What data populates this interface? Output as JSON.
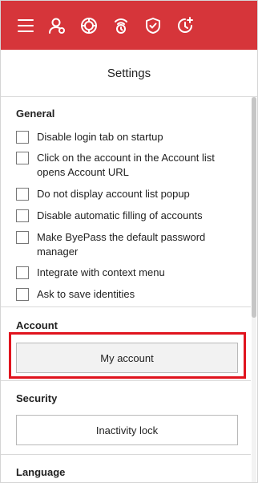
{
  "toolbar": {
    "accent": "#d6353a",
    "icons": [
      "menu-icon",
      "account-icon",
      "passwords-icon",
      "generator-icon",
      "security-icon",
      "history-icon"
    ]
  },
  "header": {
    "title": "Settings"
  },
  "general": {
    "title": "General",
    "options": [
      "Disable login tab on startup",
      "Click on the account in the Account list opens Account URL",
      "Do not display account list popup",
      "Disable automatic filling of accounts",
      "Make ByePass the default password manager",
      "Integrate with context menu",
      "Ask to save identities"
    ]
  },
  "account": {
    "title": "Account",
    "button": "My account"
  },
  "security": {
    "title": "Security",
    "button": "Inactivity lock"
  },
  "language": {
    "title": "Language"
  }
}
